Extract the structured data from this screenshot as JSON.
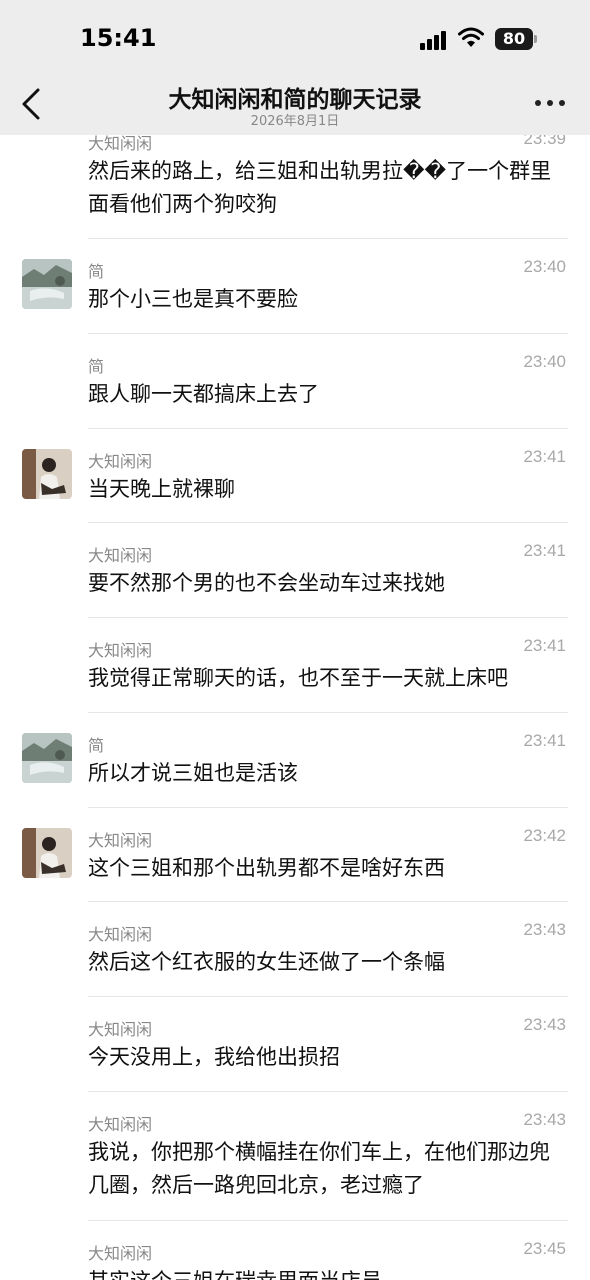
{
  "status_bar": {
    "time": "15:41",
    "battery": "80"
  },
  "header": {
    "title": "大知闲闲和简的聊天记录",
    "subtitle": "2026年8月1日"
  },
  "messages": [
    {
      "sender": "大知闲闲",
      "time": "23:39",
      "text": "然后来的路上，给三姐和出轨男拉��了一个群里面看他们两个狗咬狗"
    },
    {
      "sender": "简",
      "time": "23:40",
      "text": "那个小三也是真不要脸"
    },
    {
      "sender": "简",
      "time": "23:40",
      "text": "跟人聊一天都搞床上去了"
    },
    {
      "sender": "大知闲闲",
      "time": "23:41",
      "text": "当天晚上就裸聊"
    },
    {
      "sender": "大知闲闲",
      "time": "23:41",
      "text": "要不然那个男的也不会坐动车过来找她"
    },
    {
      "sender": "大知闲闲",
      "time": "23:41",
      "text": "我觉得正常聊天的话，也不至于一天就上床吧"
    },
    {
      "sender": "简",
      "time": "23:41",
      "text": "所以才说三姐也是活该"
    },
    {
      "sender": "大知闲闲",
      "time": "23:42",
      "text": "这个三姐和那个出轨男都不是啥好东西"
    },
    {
      "sender": "大知闲闲",
      "time": "23:43",
      "text": "然后这个红衣服的女生还做了一个条幅"
    },
    {
      "sender": "大知闲闲",
      "time": "23:43",
      "text": "今天没用上，我给他出损招"
    },
    {
      "sender": "大知闲闲",
      "time": "23:43",
      "text": "我说，你把那个横幅挂在你们车上，在他们那边兜几圈，然后一路兜回北京，老过瘾了"
    },
    {
      "sender": "大知闲闲",
      "time": "23:45",
      "text": "其实这个三姐在瑞幸里面当店员"
    }
  ],
  "icons": {
    "back": "chevron-left-icon",
    "more": "more-dots-icon",
    "signal": "cellular-signal-icon",
    "wifi": "wifi-icon",
    "battery": "battery-icon"
  }
}
